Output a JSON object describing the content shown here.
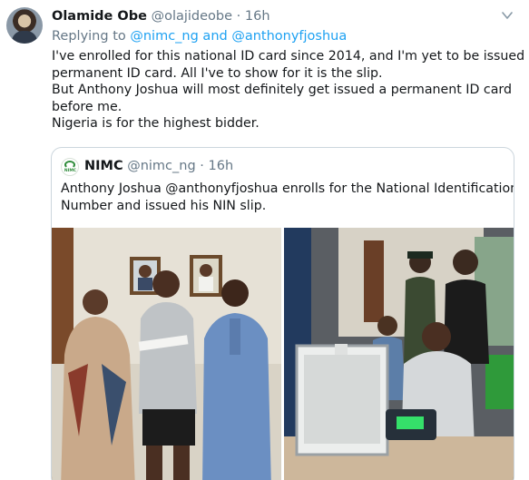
{
  "tweet": {
    "author_name": "Olamide Obe",
    "author_handle": "@olajideobe",
    "separator": "·",
    "time": "16h",
    "replying_prefix": "Replying to ",
    "replying_mention_1": "@nimc_ng",
    "replying_and": " and ",
    "replying_mention_2": "@anthonyfjoshua",
    "text_lines": [
      "I've enrolled for this national ID card since 2014, and I'm yet to be issued a",
      "permanent ID card. All I've to show for it is the slip.",
      "But Anthony Joshua will most definitely get issued a permanent ID card",
      "before me.",
      "Nigeria is for the highest bidder."
    ]
  },
  "quoted_tweet": {
    "author_name": "NIMC",
    "author_handle": "@nimc_ng",
    "separator": "·",
    "time": "16h",
    "avatar_text": "NIMC",
    "text_lines": [
      "Anthony Joshua @anthonyfjoshua enrolls for the National Identification",
      "Number and issued his NIN slip."
    ]
  },
  "icons": {
    "caret": "chevron-down-icon",
    "author_avatar": "avatar",
    "quoted_avatar": "nimc-logo-avatar"
  },
  "colors": {
    "link": "#1da1f2",
    "secondary_text": "#657786",
    "border": "#ccd6dd",
    "nimc_green": "#2e8b3a"
  }
}
